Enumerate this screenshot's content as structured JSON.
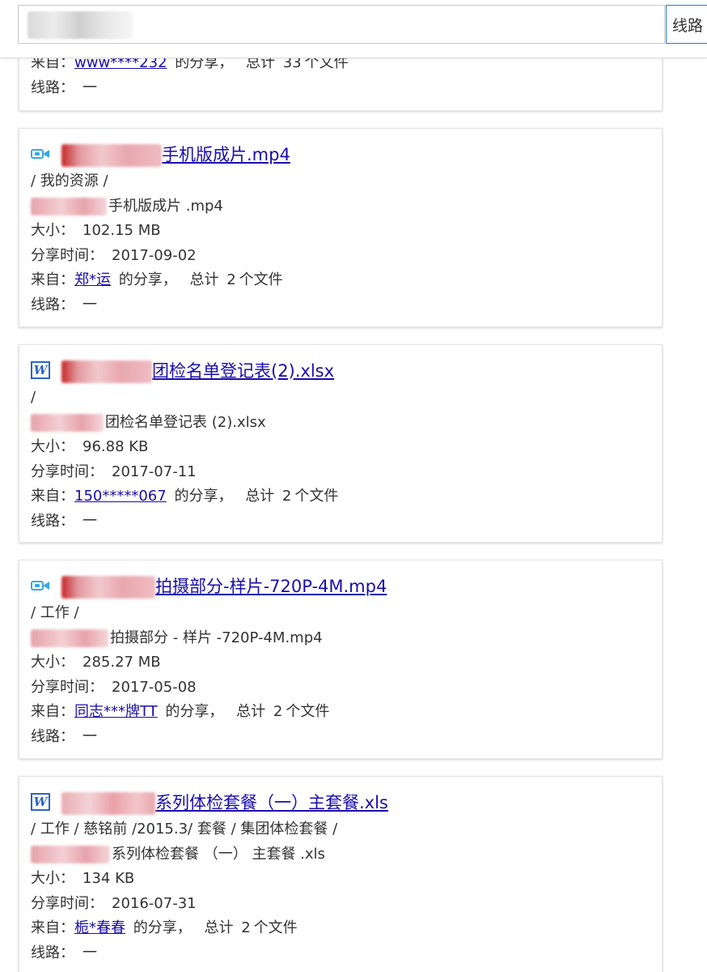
{
  "search": {
    "value": "",
    "route_label": "线路"
  },
  "labels": {
    "size": "大小：",
    "share_time": "分享时间：",
    "from": "来自：",
    "share_suffix": "的分享，",
    "total_prefix": "总计",
    "files_suffix": "个文件",
    "route": "线路：",
    "route_value": "一"
  },
  "partial_card": {
    "from_user": "www****232",
    "total": "33"
  },
  "cards": [
    {
      "icon": "video-icon",
      "title": "手机版成片.mp4",
      "folder": "/ 我的资源 /",
      "filename": "手机版成片 .mp4",
      "size": "102.15 MB",
      "share_time": "2017-09-02",
      "from_user": "郑*运",
      "total": "2"
    },
    {
      "icon": "word-icon",
      "title": "团检名单登记表(2).xlsx",
      "folder": "/",
      "filename": "团检名单登记表 (2).xlsx",
      "size": "96.88 KB",
      "share_time": "2017-07-11",
      "from_user": "150*****067",
      "total": "2"
    },
    {
      "icon": "video-icon",
      "title": "拍摄部分-样片-720P-4M.mp4",
      "folder": "/ 工作 /",
      "filename": "拍摄部分 - 样片 -720P-4M.mp4",
      "size": "285.27 MB",
      "share_time": "2017-05-08",
      "from_user": "同志***牌TT",
      "total": "2"
    },
    {
      "icon": "word-icon",
      "title": "系列体检套餐（一）主套餐.xls",
      "folder": "/ 工作 / 慈铭前 /2015.3/ 套餐 / 集团体检套餐 /",
      "filename": "系列体检套餐 （一） 主套餐 .xls",
      "size": "134 KB",
      "share_time": "2016-07-31",
      "from_user": "栀*春春",
      "total": "2"
    }
  ]
}
